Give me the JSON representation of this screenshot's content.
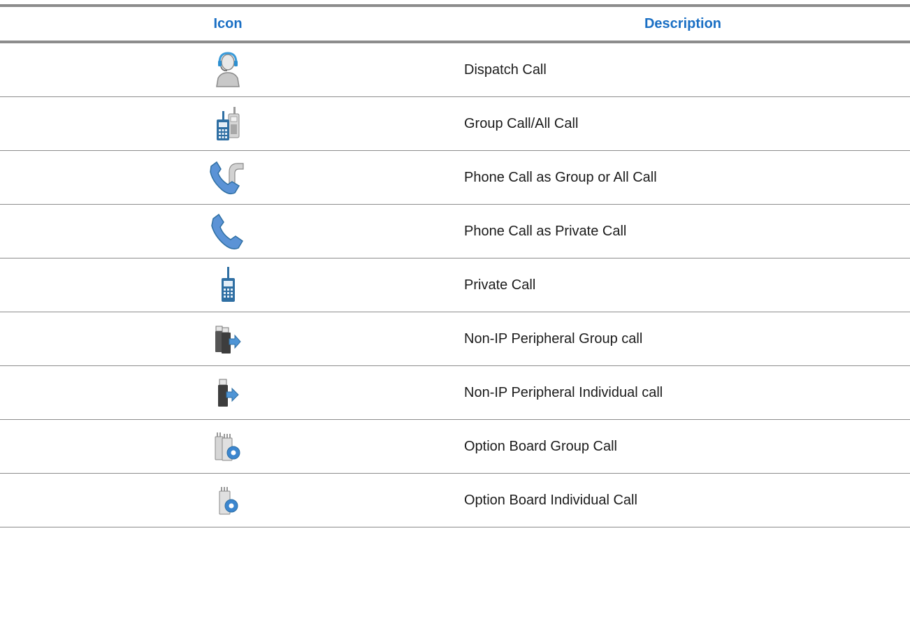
{
  "table": {
    "headers": {
      "icon": "Icon",
      "description": "Description"
    },
    "rows": [
      {
        "icon": "dispatch-call-icon",
        "description": "Dispatch Call"
      },
      {
        "icon": "group-call-icon",
        "description": "Group Call/All Call"
      },
      {
        "icon": "phone-group-call-icon",
        "description": "Phone Call as Group or All Call"
      },
      {
        "icon": "phone-private-call-icon",
        "description": "Phone Call as Private Call"
      },
      {
        "icon": "private-call-icon",
        "description": "Private Call"
      },
      {
        "icon": "non-ip-peripheral-group-call-icon",
        "description": "Non-IP Peripheral Group call"
      },
      {
        "icon": "non-ip-peripheral-individual-call-icon",
        "description": "Non-IP Peripheral Individual call"
      },
      {
        "icon": "option-board-group-call-icon",
        "description": "Option Board Group Call"
      },
      {
        "icon": "option-board-individual-call-icon",
        "description": "Option Board Individual Call"
      }
    ]
  },
  "colors": {
    "header_text": "#1a6fc4",
    "rule": "#8c8c8c",
    "icon_blue": "#5b93d6",
    "radio_blue": "#2f6fa3"
  }
}
